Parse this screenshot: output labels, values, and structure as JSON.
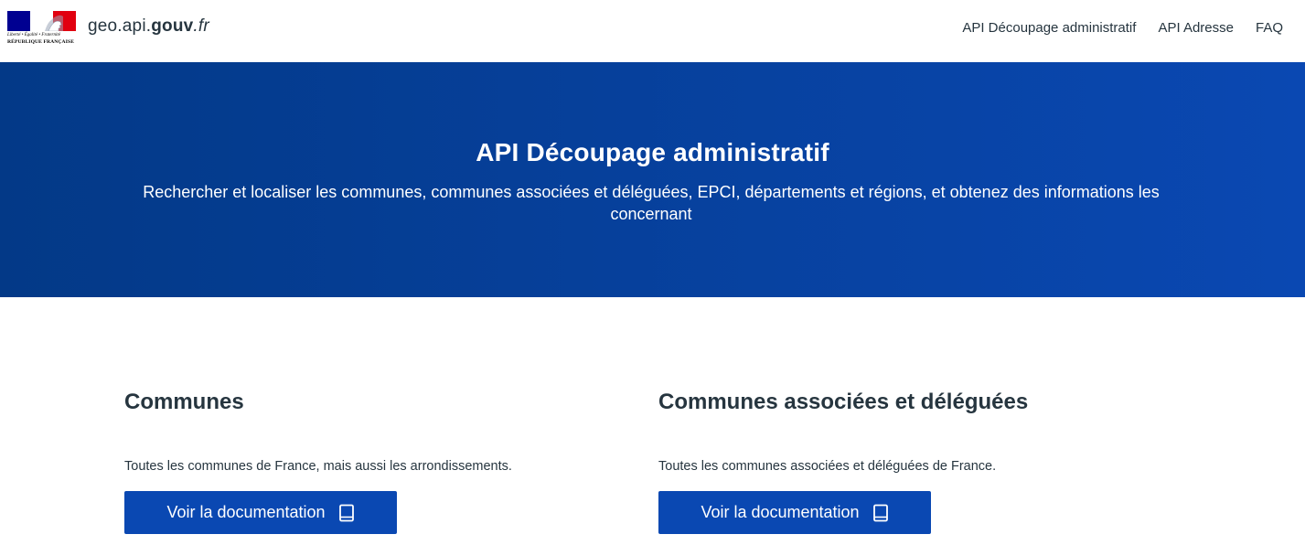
{
  "header": {
    "motto": "Liberté • Égalité • Fraternité",
    "republique": "RÉPUBLIQUE FRANÇAISE",
    "site_name_prefix": "geo.api.",
    "site_name_strong": "gouv",
    "site_name_tld": ".fr",
    "nav": [
      {
        "label": "API Découpage administratif"
      },
      {
        "label": "API Adresse"
      },
      {
        "label": "FAQ"
      }
    ]
  },
  "hero": {
    "title": "API Découpage administratif",
    "subtitle": "Rechercher et localiser les communes, communes associées et déléguées, EPCI, départements et régions, et obtenez des informations les concernant"
  },
  "cards": [
    {
      "title": "Communes",
      "description": "Toutes les communes de France, mais aussi les arrondissements.",
      "button_label": "Voir la documentation",
      "button_icon": "book-icon"
    },
    {
      "title": "Communes associées et déléguées",
      "description": "Toutes les communes associées et déléguées de France.",
      "button_label": "Voir la documentation",
      "button_icon": "book-icon"
    }
  ],
  "colors": {
    "primary": "#0a48b2",
    "hero_start": "#033987",
    "hero_end": "#0a48b2",
    "text": "#26353f",
    "flag_blue": "#000091",
    "flag_red": "#e1000f"
  }
}
